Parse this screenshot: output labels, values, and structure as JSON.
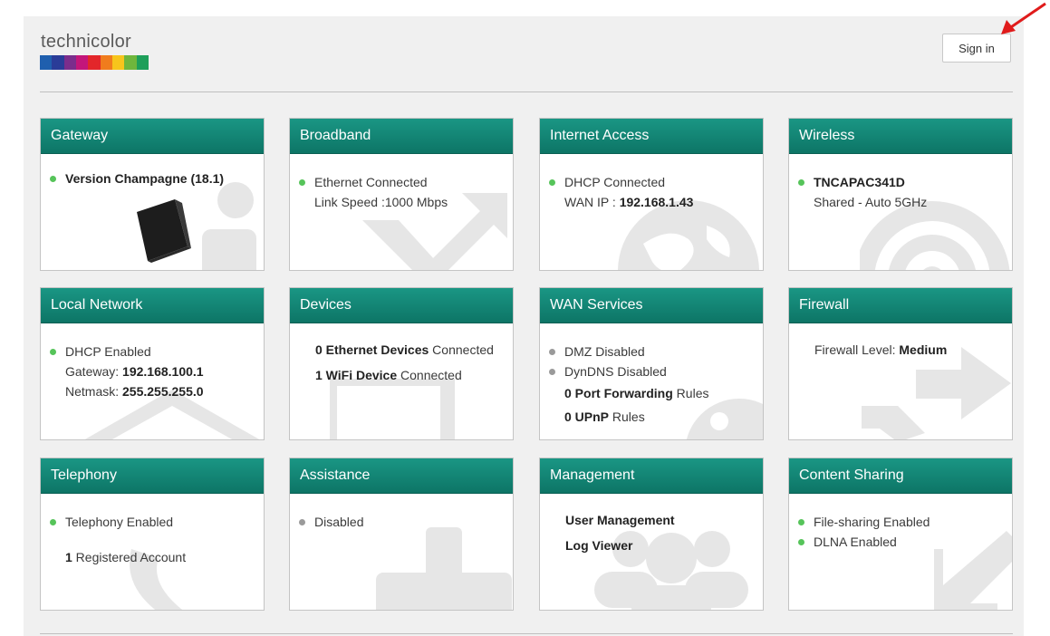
{
  "header": {
    "brand": "technicolor",
    "brand_colors": [
      "#1f5fae",
      "#2a3c98",
      "#7b2d8c",
      "#c3167a",
      "#e3262a",
      "#f07c1d",
      "#f7c51c",
      "#6fb63c",
      "#1e9f5a"
    ],
    "signin_label": "Sign in",
    "accent": "#138a79"
  },
  "cards": {
    "gateway": {
      "title": "Gateway",
      "version": "Version Champagne (18.1)"
    },
    "broadband": {
      "title": "Broadband",
      "status": "Ethernet Connected",
      "speed": "Link Speed :1000 Mbps"
    },
    "internet": {
      "title": "Internet Access",
      "status": "DHCP Connected",
      "wan_ip_label": "WAN IP : ",
      "wan_ip": "192.168.1.43"
    },
    "wireless": {
      "title": "Wireless",
      "ssid": "TNCAPAC341D",
      "mode": "Shared - Auto 5GHz"
    },
    "local": {
      "title": "Local Network",
      "dhcp": "DHCP Enabled",
      "gateway_label": "Gateway: ",
      "gateway": "192.168.100.1",
      "netmask_label": "Netmask: ",
      "netmask": "255.255.255.0"
    },
    "devices": {
      "title": "Devices",
      "eth_count": "0 Ethernet Devices",
      "eth_suffix": " Connected",
      "wifi_count": "1 WiFi Device",
      "wifi_suffix": " Connected"
    },
    "wan": {
      "title": "WAN Services",
      "dmz": "DMZ Disabled",
      "dyndns": "DynDNS Disabled",
      "pf_count": "0 Port Forwarding",
      "pf_suffix": " Rules",
      "upnp_count": "0 UPnP",
      "upnp_suffix": " Rules"
    },
    "firewall": {
      "title": "Firewall",
      "level_label": "Firewall Level: ",
      "level": "Medium"
    },
    "telephony": {
      "title": "Telephony",
      "status": "Telephony Enabled",
      "accounts_count": "1",
      "accounts_suffix": " Registered Account"
    },
    "assistance": {
      "title": "Assistance",
      "status": "Disabled"
    },
    "management": {
      "title": "Management",
      "user_mgmt": "User Management",
      "log_viewer": "Log Viewer"
    },
    "content": {
      "title": "Content Sharing",
      "file_sharing": "File-sharing Enabled",
      "dlna": "DLNA Enabled"
    }
  }
}
